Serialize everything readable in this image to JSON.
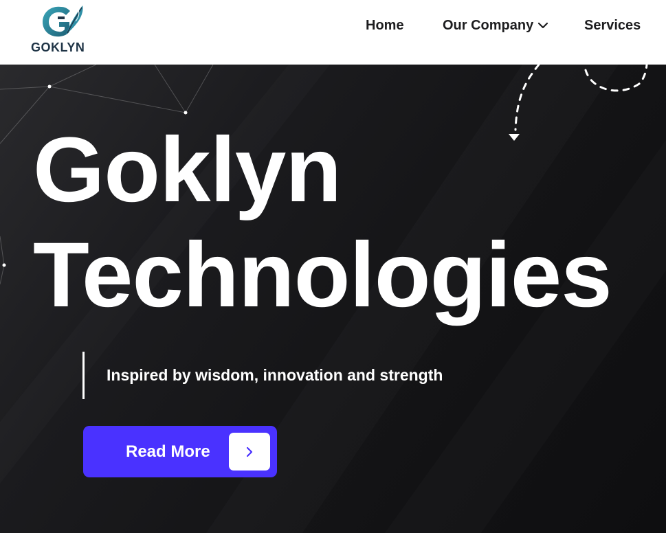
{
  "brand": {
    "name": "GOKLYN",
    "logo_icon": "goklyn-feather-g-logo",
    "colors": {
      "primary": "#4a32ff",
      "logo_teal": "#2e8fa6",
      "logo_navy": "#1f3446"
    }
  },
  "nav": {
    "home": "Home",
    "company": "Our Company",
    "services": "Services"
  },
  "hero": {
    "title_line1": "Goklyn",
    "title_line2": "Technologies",
    "tagline": "Inspired by wisdom, innovation and strength",
    "cta_label": "Read More",
    "cta_icon": "chevron-right-icon"
  }
}
